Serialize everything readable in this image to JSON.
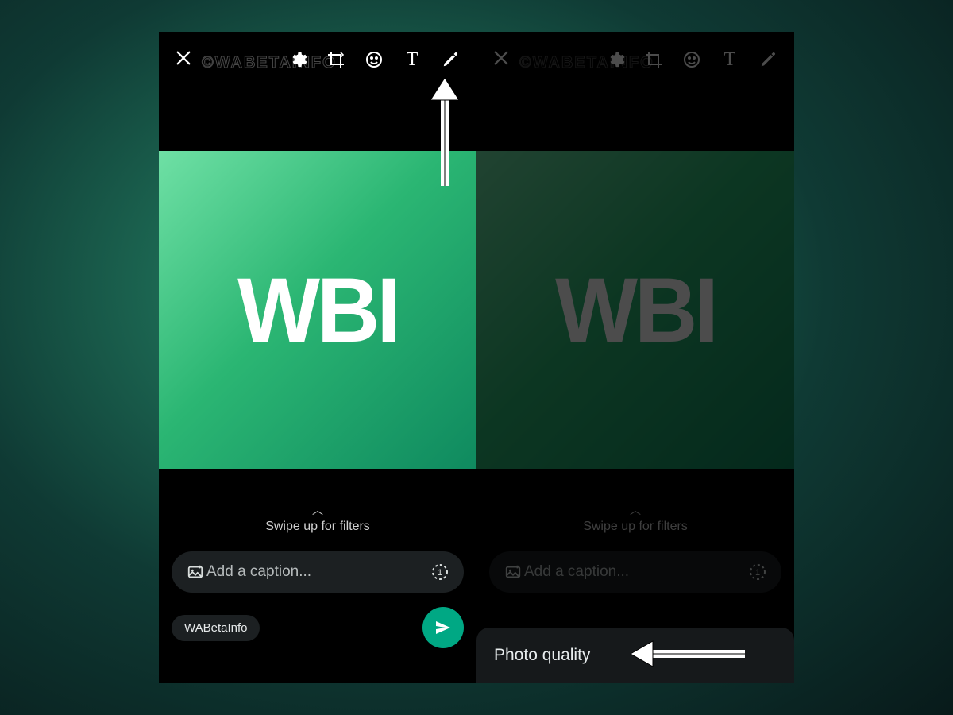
{
  "watermark_text": "©WABETAINFO",
  "left": {
    "media_text": "WBI",
    "swipe_hint": "Swipe up for filters",
    "caption_placeholder": "Add a caption...",
    "recipient_chip": "WABetaInfo",
    "toolbar": {
      "close_label": "Close",
      "settings_label": "Settings",
      "crop_label": "Crop",
      "emoji_label": "Emoji",
      "text_label": "Text",
      "draw_label": "Draw"
    }
  },
  "right": {
    "media_text": "WBI",
    "swipe_hint": "Swipe up for filters",
    "caption_placeholder": "Add a caption...",
    "sheet_title": "Photo quality",
    "toolbar": {
      "close_label": "Close",
      "settings_label": "Settings",
      "crop_label": "Crop",
      "emoji_label": "Emoji",
      "text_label": "Text",
      "draw_label": "Draw"
    }
  },
  "colors": {
    "accent": "#00a884",
    "panel_bg": "#000000",
    "input_bg": "#1c2022"
  }
}
